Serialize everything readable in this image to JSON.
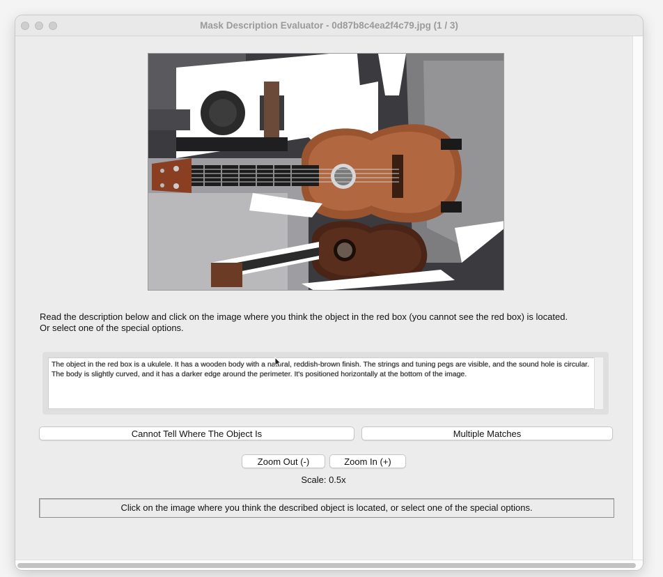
{
  "window": {
    "title": "Mask Description Evaluator - 0d87b8c4ea2f4c79.jpg (1 / 3)"
  },
  "instructions": {
    "line1": "Read the description below and click on the image where you think the object in the red box (you cannot see the red box) is located.",
    "line2": "Or select one of the special options."
  },
  "description": "The object in the red box is a ukulele. It has a wooden body with a natural, reddish-brown finish. The strings and tuning pegs are visible, and the sound hole is circular. The body is slightly curved, and it has a darker edge around the perimeter. It's positioned horizontally at the bottom of the image.",
  "buttons": {
    "cannot_tell": "Cannot Tell Where The Object Is",
    "multiple": "Multiple Matches",
    "zoom_out": "Zoom Out (-)",
    "zoom_in": "Zoom In (+)"
  },
  "scale_text": "Scale: 0.5x",
  "status_text": "Click on the image where you think the described object is located, or select one of the special options.",
  "image": {
    "subject": "guitar and ukuleles photo",
    "icon": "photo-icon"
  },
  "colors": {
    "window_bg": "#ececec",
    "wood": "#9a5430",
    "dark_wood": "#4a2416"
  }
}
